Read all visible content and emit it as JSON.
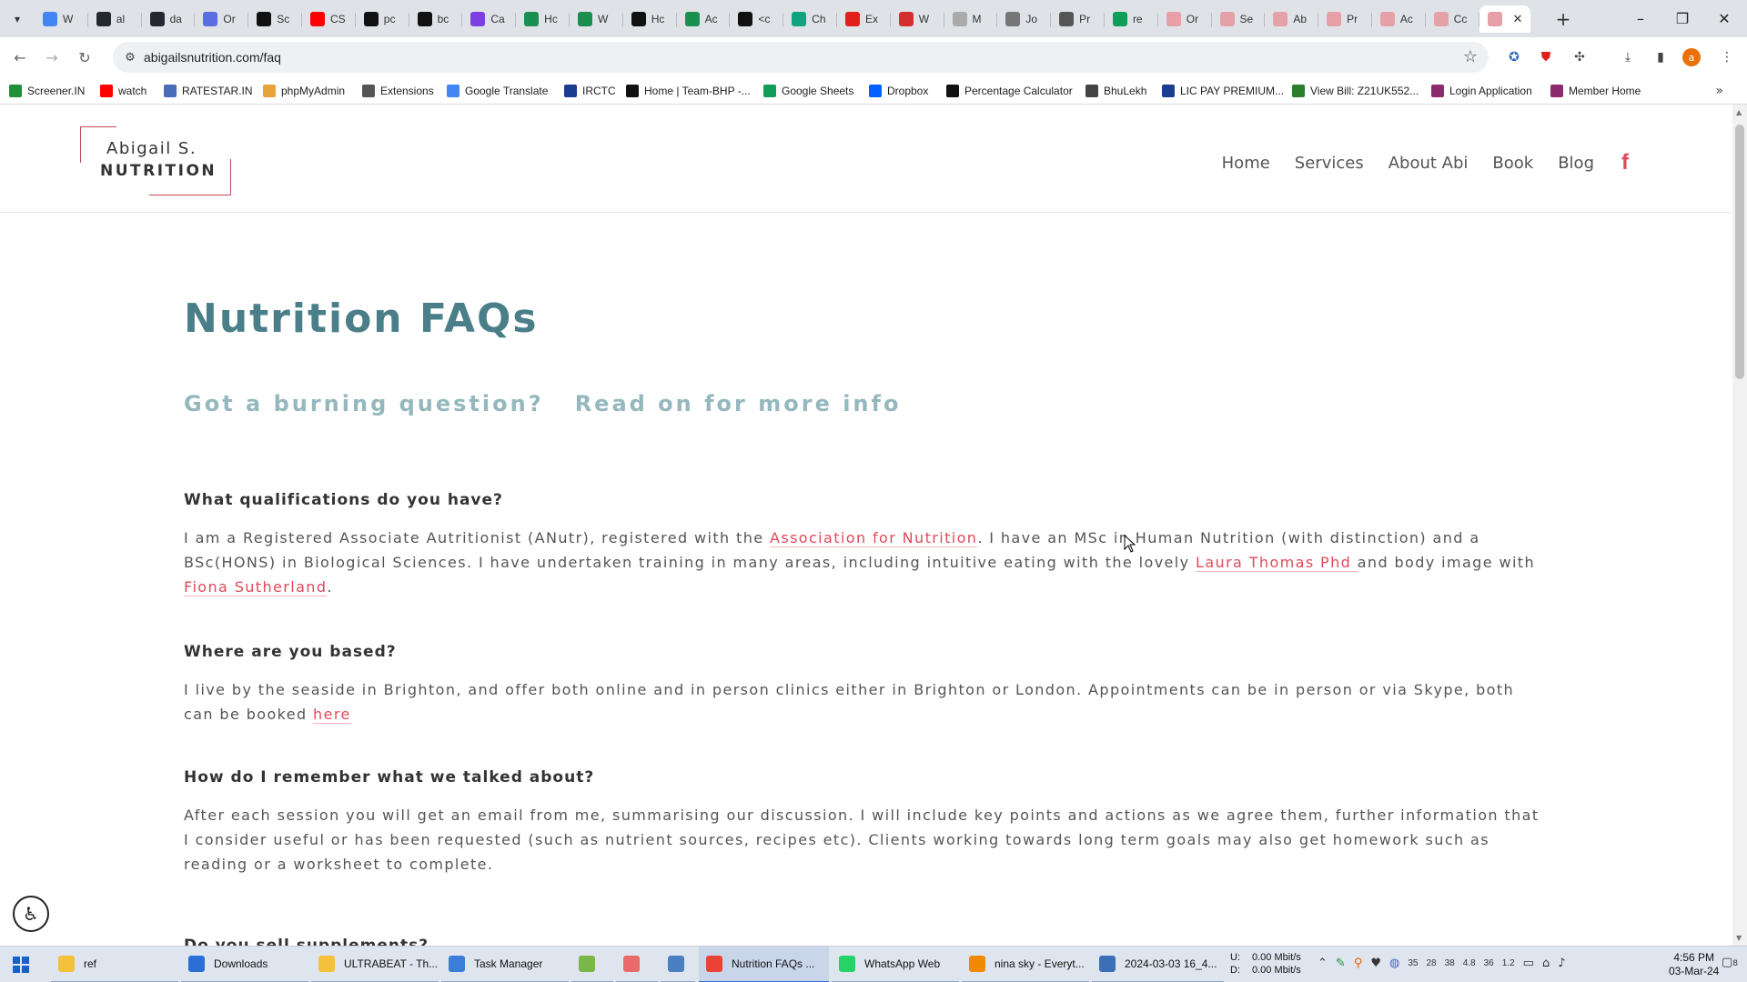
{
  "browser": {
    "tabs": [
      {
        "label": "W",
        "icon": "google-icon",
        "color": "#4285f4"
      },
      {
        "label": "al",
        "icon": "github-icon",
        "color": "#24292f"
      },
      {
        "label": "da",
        "icon": "github-icon",
        "color": "#24292f"
      },
      {
        "label": "Or",
        "icon": "openrouter-icon",
        "color": "#5b6ee1"
      },
      {
        "label": "Sc",
        "icon": "screener-icon",
        "color": "#111111"
      },
      {
        "label": "CS",
        "icon": "youtube-icon",
        "color": "#ff0000"
      },
      {
        "label": "pc",
        "icon": "medium-icon",
        "color": "#111111"
      },
      {
        "label": "bc",
        "icon": "medium-icon",
        "color": "#111111"
      },
      {
        "label": "Ca",
        "icon": "b-icon",
        "color": "#7b3fe4"
      },
      {
        "label": "Hc",
        "icon": "w-icon",
        "color": "#1b8f4f"
      },
      {
        "label": "W",
        "icon": "w-icon",
        "color": "#1b8f4f"
      },
      {
        "label": "Hc",
        "icon": "a-icon",
        "color": "#111111"
      },
      {
        "label": "Ac",
        "icon": "link-icon",
        "color": "#1b8f4f"
      },
      {
        "label": "<c",
        "icon": "medium-icon",
        "color": "#111111"
      },
      {
        "label": "Ch",
        "icon": "chatgpt-icon",
        "color": "#10a37f"
      },
      {
        "label": "Ex",
        "icon": "pdf-icon",
        "color": "#e0201b"
      },
      {
        "label": "W",
        "icon": "upwork-icon",
        "color": "#d32f2f"
      },
      {
        "label": "M",
        "icon": "circle-icon",
        "color": "#aaaaaa"
      },
      {
        "label": "Jo",
        "icon": "jo-icon",
        "color": "#777777"
      },
      {
        "label": "Pr",
        "icon": "wiki-icon",
        "color": "#555555"
      },
      {
        "label": "re",
        "icon": "sheets-plus-icon",
        "color": "#0f9d58"
      },
      {
        "label": "Or",
        "icon": "abi-icon",
        "color": "#e6a1a8"
      },
      {
        "label": "Se",
        "icon": "abi-icon",
        "color": "#e6a1a8"
      },
      {
        "label": "Ab",
        "icon": "abi-icon",
        "color": "#e6a1a8"
      },
      {
        "label": "Pr",
        "icon": "abi-icon",
        "color": "#e6a1a8"
      },
      {
        "label": "Ac",
        "icon": "abi-icon",
        "color": "#e6a1a8"
      },
      {
        "label": "Cc",
        "icon": "abi-icon",
        "color": "#e6a1a8"
      },
      {
        "label": "",
        "icon": "abi-icon",
        "color": "#e6a1a8",
        "active": true
      }
    ],
    "url": "abigailsnutrition.com/faq",
    "bookmarks": [
      {
        "label": "Screener.IN",
        "icon": "bar-chart-icon",
        "color": "#1f8f3a"
      },
      {
        "label": "watch",
        "icon": "youtube-icon",
        "color": "#ff0000"
      },
      {
        "label": "RATESTAR.IN",
        "icon": "ratestar-icon",
        "color": "#4b6cb7"
      },
      {
        "label": "phpMyAdmin",
        "icon": "phpmyadmin-icon",
        "color": "#e8a33d"
      },
      {
        "label": "Extensions",
        "icon": "puzzle-icon",
        "color": "#555555"
      },
      {
        "label": "Google Translate",
        "icon": "translate-icon",
        "color": "#4285f4"
      },
      {
        "label": "IRCTC",
        "icon": "irctc-icon",
        "color": "#1a3d8f"
      },
      {
        "label": "Home | Team-BHP -...",
        "icon": "teambhp-icon",
        "color": "#111111"
      },
      {
        "label": "Google Sheets",
        "icon": "sheets-icon",
        "color": "#0f9d58"
      },
      {
        "label": "Dropbox",
        "icon": "dropbox-icon",
        "color": "#0061ff"
      },
      {
        "label": "Percentage Calculator",
        "icon": "percent-icon",
        "color": "#111111"
      },
      {
        "label": "BhuLekh",
        "icon": "globe-icon",
        "color": "#444444"
      },
      {
        "label": "LIC PAY PREMIUM...",
        "icon": "lic-icon",
        "color": "#1a3d8f"
      },
      {
        "label": "View Bill: Z21UK552...",
        "icon": "bill-icon",
        "color": "#2c7d2c"
      },
      {
        "label": "Login Application",
        "icon": "login-icon",
        "color": "#8b2c6f"
      },
      {
        "label": "Member Home",
        "icon": "member-icon",
        "color": "#8b2c6f"
      }
    ]
  },
  "site": {
    "logo": {
      "name": "Abigail S.",
      "subtitle": "NUTRITION"
    },
    "nav": [
      "Home",
      "Services",
      "About Abi",
      "Book",
      "Blog"
    ],
    "social_icon": "facebook-icon",
    "brand_color": "#e04a5a",
    "heading_color": "#4a7f8a"
  },
  "faq_page": {
    "title": "Nutrition FAQs",
    "subtitle": "Got a burning question?   Read on for more info",
    "items": [
      {
        "question": "What qualifications do you have?",
        "answer_parts": [
          {
            "text": "I am a Registered Associate Autritionist (ANutr), registered with the "
          },
          {
            "text": "Association for Nutrition",
            "link": true
          },
          {
            "text": ". I have an MSc in Human Nutrition (with distinction) and a BSc(HONS) in Biological Sciences. I have undertaken training in many areas, including intuitive eating with the lovely "
          },
          {
            "text": "Laura Thomas Phd ",
            "link": true
          },
          {
            "text": "and body image with "
          },
          {
            "text": "Fiona Sutherland",
            "link": true
          },
          {
            "text": "."
          }
        ]
      },
      {
        "question": "Where are you based?",
        "answer_parts": [
          {
            "text": "I live by the seaside in Brighton, and offer both online and in person clinics either in Brighton or London. Appointments can be in person or via Skype, both can be booked "
          },
          {
            "text": "here",
            "link": true
          }
        ]
      },
      {
        "question": "How do I remember what we talked about?",
        "answer_parts": [
          {
            "text": "After each session you will get an email from me, summarising our discussion. I will include key points and actions as we agree them, further information that I consider useful or has been requested (such as nutrient sources, recipes etc). Clients working towards long term goals may also get homework such as reading or a worksheet to complete."
          }
        ]
      },
      {
        "question": "Do you sell supplements?",
        "answer_parts": []
      }
    ]
  },
  "taskbar": {
    "items": [
      {
        "label": "ref",
        "icon": "folder-icon",
        "color": "#f3c13a"
      },
      {
        "label": "Downloads",
        "icon": "download-folder-icon",
        "color": "#2b6fd6"
      },
      {
        "label": "ULTRABEAT - Th...",
        "icon": "folder-icon",
        "color": "#f3c13a"
      },
      {
        "label": "Task Manager",
        "icon": "task-manager-icon",
        "color": "#3b7dd8"
      },
      {
        "label": "",
        "icon": "notepadpp-icon",
        "color": "#7ab648"
      },
      {
        "label": "",
        "icon": "app-icon",
        "color": "#e86a6a"
      },
      {
        "label": "",
        "icon": "notepad-icon",
        "color": "#4a7fc1"
      },
      {
        "label": "Nutrition FAQs ...",
        "icon": "chrome-icon",
        "color": "#ea4335",
        "active": true
      },
      {
        "label": "WhatsApp Web",
        "icon": "whatsapp-icon",
        "color": "#25d366"
      },
      {
        "label": "nina sky - Everyt...",
        "icon": "everything-search-icon",
        "color": "#f08a00"
      },
      {
        "label": "2024-03-03 16_4...",
        "icon": "image-viewer-icon",
        "color": "#3d6fb6"
      }
    ],
    "net_up_label": "U:",
    "net_up": "0.00 Mbit/s",
    "net_down_label": "D:",
    "net_down": "0.00 Mbit/s",
    "tray_nums": [
      "35",
      "28",
      "38",
      "4.8",
      "36",
      "1.2"
    ],
    "time": "4:56 PM",
    "date": "03-Mar-24",
    "notif_count": "8"
  }
}
